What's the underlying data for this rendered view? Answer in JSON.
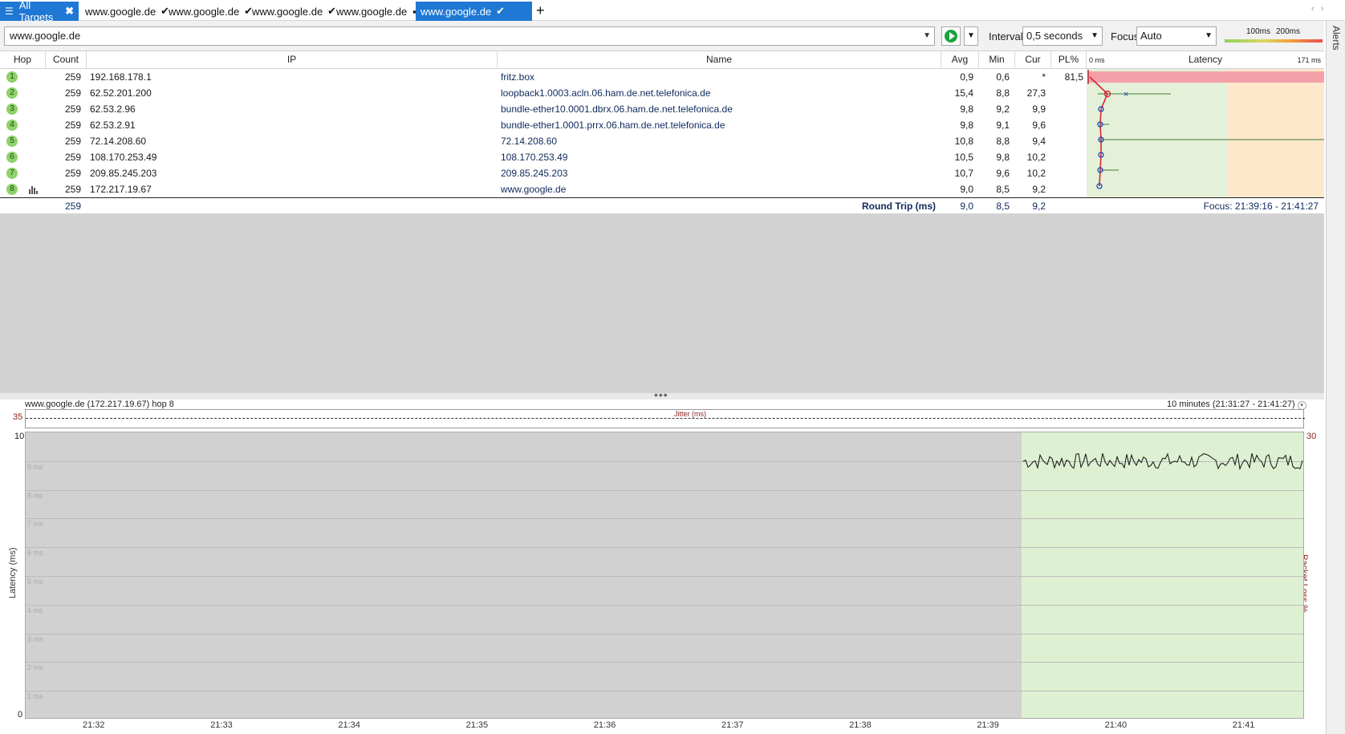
{
  "tabs": {
    "all_label": "All Targets",
    "items": [
      "www.google.de",
      "www.google.de",
      "www.google.de",
      "www.google.de",
      "www.google.de"
    ],
    "active_index": 4
  },
  "toolbar": {
    "target_value": "www.google.de",
    "interval_label": "Interval",
    "interval_value": "0,5 seconds",
    "focus_label": "Focus",
    "focus_value": "Auto",
    "scale_100": "100ms",
    "scale_200": "200ms"
  },
  "alerts_label": "Alerts",
  "table": {
    "headers": {
      "hop": "Hop",
      "count": "Count",
      "ip": "IP",
      "name": "Name",
      "avg": "Avg",
      "min": "Min",
      "cur": "Cur",
      "pl": "PL%",
      "latency": "Latency",
      "lat_min": "0 ms",
      "lat_max": "171 ms"
    },
    "rows": [
      {
        "hop": "1",
        "count": "259",
        "ip": "192.168.178.1",
        "name": "fritz.box",
        "avg": "0,9",
        "min": "0,6",
        "cur": "*",
        "pl": "81,5"
      },
      {
        "hop": "2",
        "count": "259",
        "ip": "62.52.201.200",
        "name": "loopback1.0003.acln.06.ham.de.net.telefonica.de",
        "avg": "15,4",
        "min": "8,8",
        "cur": "27,3",
        "pl": ""
      },
      {
        "hop": "3",
        "count": "259",
        "ip": "62.53.2.96",
        "name": "bundle-ether10.0001.dbrx.06.ham.de.net.telefonica.de",
        "avg": "9,8",
        "min": "9,2",
        "cur": "9,9",
        "pl": ""
      },
      {
        "hop": "4",
        "count": "259",
        "ip": "62.53.2.91",
        "name": "bundle-ether1.0001.prrx.06.ham.de.net.telefonica.de",
        "avg": "9,8",
        "min": "9,1",
        "cur": "9,6",
        "pl": ""
      },
      {
        "hop": "5",
        "count": "259",
        "ip": "72.14.208.60",
        "name": "72.14.208.60",
        "avg": "10,8",
        "min": "8,8",
        "cur": "9,4",
        "pl": ""
      },
      {
        "hop": "6",
        "count": "259",
        "ip": "108.170.253.49",
        "name": "108.170.253.49",
        "avg": "10,5",
        "min": "9,8",
        "cur": "10,2",
        "pl": ""
      },
      {
        "hop": "7",
        "count": "259",
        "ip": "209.85.245.203",
        "name": "209.85.245.203",
        "avg": "10,7",
        "min": "9,6",
        "cur": "10,2",
        "pl": ""
      },
      {
        "hop": "8",
        "count": "259",
        "ip": "172.217.19.67",
        "name": "www.google.de",
        "avg": "9,0",
        "min": "8,5",
        "cur": "9,2",
        "pl": ""
      }
    ],
    "round_trip": {
      "count": "259",
      "label": "Round Trip (ms)",
      "avg": "9,0",
      "min": "8,5",
      "cur": "9,2",
      "focus": "Focus: 21:39:16 - 21:41:27"
    }
  },
  "graph": {
    "title": "www.google.de (172.217.19.67) hop 8",
    "time_range": "10 minutes (21:31:27 - 21:41:27)",
    "jitter_label": "Jitter (ms)",
    "jitter_max": "35",
    "y_top": "10",
    "y_bottom": "0",
    "y_right_top": "30",
    "y_axis_title": "Latency (ms)",
    "y_axis_title_right": "Packet Loss %",
    "grid_labels": [
      "9 ms",
      "8 ms",
      "7 ms",
      "6 ms",
      "5 ms",
      "4 ms",
      "3 ms",
      "2 ms",
      "1 ms"
    ],
    "x_ticks": [
      "21:32",
      "21:33",
      "21:34",
      "21:35",
      "21:36",
      "21:37",
      "21:38",
      "21:39",
      "21:40",
      "21:41"
    ]
  },
  "colors": {
    "accent": "#1e78d4",
    "ok_green": "#8fd16a",
    "loss_red": "#f4a0a8",
    "latency_green": "#e4f1d8",
    "latency_orange": "#fde8cc"
  }
}
